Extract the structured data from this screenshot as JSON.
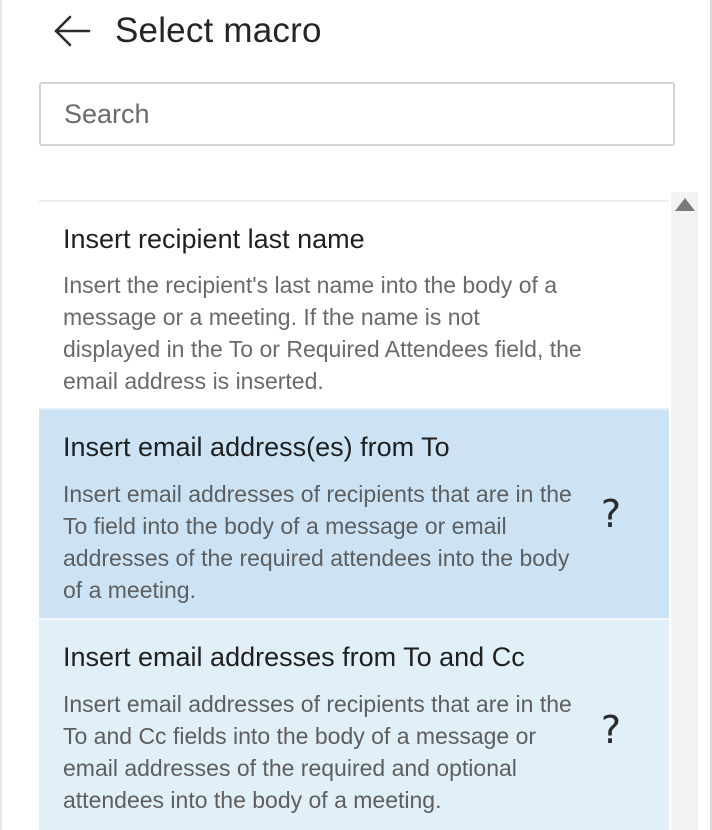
{
  "header": {
    "title": "Select macro",
    "back_icon": "arrow-left-icon"
  },
  "search": {
    "placeholder": "Search",
    "value": ""
  },
  "macros": [
    {
      "title": "Insert recipient last name",
      "description": "Insert the recipient's last name into the body of a message or a meeting. If the name is not displayed in the To or Required Attendees field, the email address is inserted.",
      "help": ""
    },
    {
      "title": "Insert email address(es) from To",
      "description": "Insert email addresses of recipients that are in the To field into the body of a message or email addresses of the required attendees into the body of a meeting.",
      "help": "?"
    },
    {
      "title": "Insert email addresses from To and Cc",
      "description": "Insert email addresses of recipients that are in the To and Cc fields into the body of a message or email addresses of the required and optional attendees into the body of a meeting.",
      "help": "?"
    }
  ],
  "colors": {
    "selected_item_bg": "#cbe3f4",
    "hover_item_bg": "#e1eff8",
    "title_text": "#252525",
    "description_text": "#6a6a6a"
  }
}
